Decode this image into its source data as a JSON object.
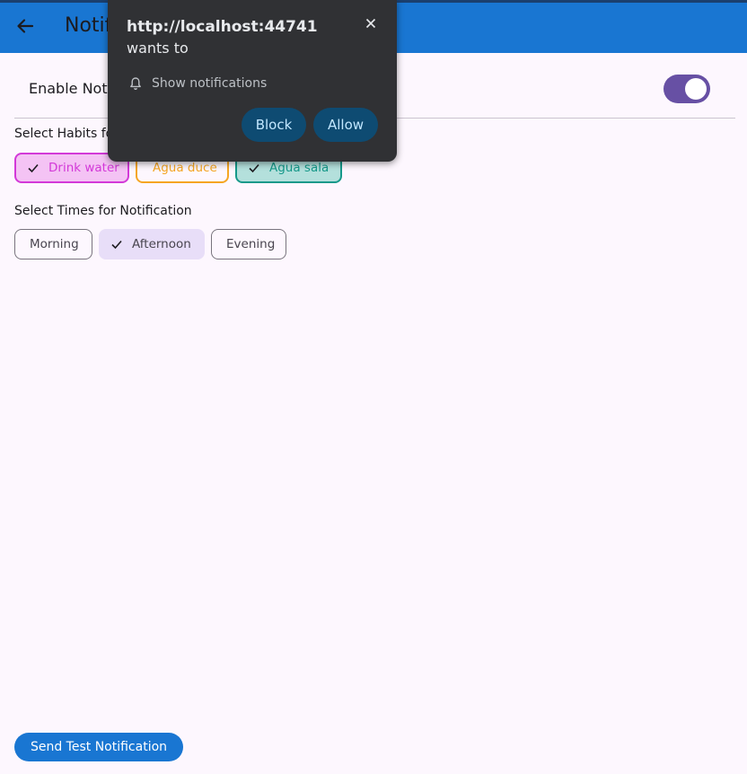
{
  "appbar": {
    "title": "Notification Settings"
  },
  "settings": {
    "enable_label": "Enable Notifications",
    "enable_on": true,
    "habits_label": "Select Habits for Notification",
    "times_label": "Select Times for Notification"
  },
  "habits": [
    {
      "label": "Drink water",
      "selected": true,
      "color": "#d339d8"
    },
    {
      "label": "Agua duce",
      "selected": false,
      "color": "#f5a623"
    },
    {
      "label": "Agua sala",
      "selected": true,
      "color": "#16998a"
    }
  ],
  "times": [
    {
      "label": "Morning",
      "selected": false
    },
    {
      "label": "Afternoon",
      "selected": true
    },
    {
      "label": "Evening",
      "selected": false
    }
  ],
  "send_button": "Send Test Notification",
  "popup": {
    "origin": "http://localhost:44741",
    "wants_to": "wants to",
    "permission": "Show notifications",
    "block": "Block",
    "allow": "Allow"
  },
  "colors": {
    "appbar": "#1976d2",
    "switch": "#6750a4",
    "popup_bg": "#303134",
    "popup_button": "#0e4b72"
  }
}
